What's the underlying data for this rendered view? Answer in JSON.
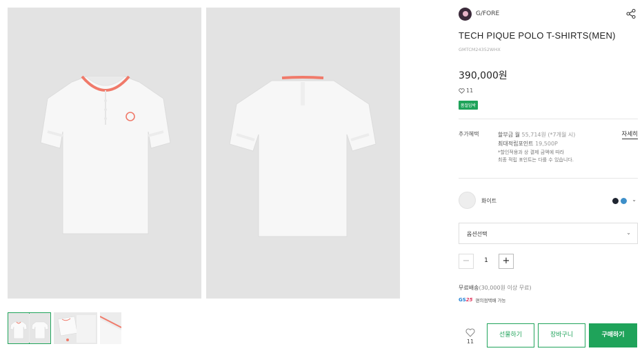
{
  "product": {
    "brand": "G/FORE",
    "title": "TECH PIQUE POLO T-SHIRTS(MEN)",
    "code": "GMTCM24352WHX",
    "price": "390,000원",
    "likes": "11",
    "badge": "품절임박"
  },
  "benefits": {
    "label": "추가혜택",
    "line1_prefix": "할부금 월 ",
    "line1_value": "55,714원 (*7개월 시)",
    "line2_prefix": "최대적립포인트 ",
    "line2_value": "19,500P",
    "note1": "*할인적용과 상 결제 금액에 따라",
    "note2": "최종 적립 포인트는 다를 수 있습니다.",
    "detail_link": "자세히"
  },
  "color": {
    "selected_name": "화이트",
    "options": [
      "#1f2530",
      "#3d8fc9"
    ],
    "chevron": "⌄"
  },
  "option_select": {
    "label": "옵션선택",
    "chevron": "⌄"
  },
  "quantity": {
    "minus": "−",
    "value": "1",
    "plus": "+"
  },
  "shipping": {
    "label": "무료배송",
    "condition": "(30,000원 이상 무료)",
    "gs_logo_a": "GS",
    "gs_logo_b": "25",
    "gs_text": "편의점택배 가능"
  },
  "actions": {
    "wish_count": "11",
    "gift": "선물하기",
    "cart": "장바구니",
    "buy": "구매하기"
  },
  "colors": {
    "accent": "#1fa35a",
    "collar": "#f07a6a"
  }
}
